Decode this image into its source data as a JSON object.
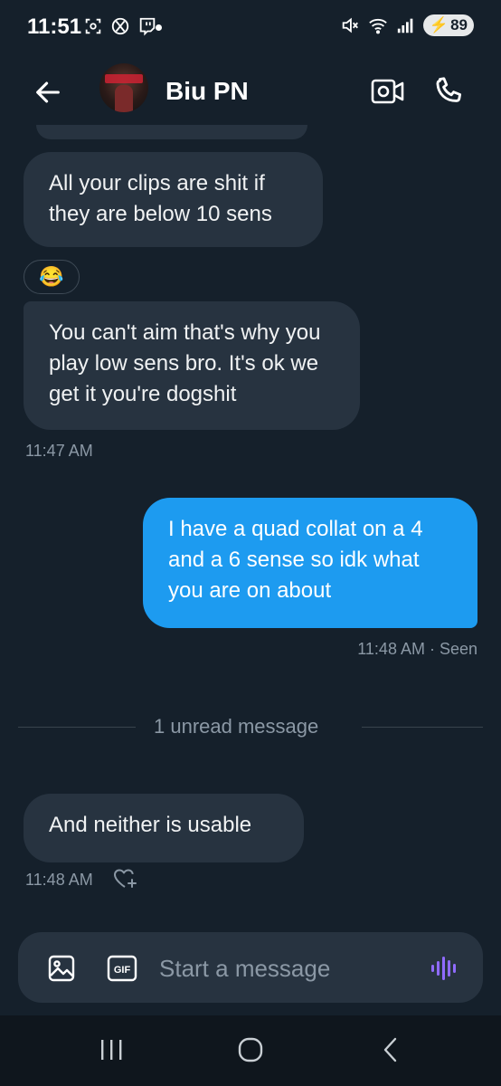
{
  "status_bar": {
    "time": "11:51",
    "battery": "89"
  },
  "header": {
    "contact_name": "Biu PN"
  },
  "messages": [
    {
      "from": "them",
      "text": "All your clips are shit if they are below 10 sens"
    },
    {
      "from": "them",
      "text": "You can't aim that's why you play low sens bro. It's ok we get it you're dogshit",
      "reaction": "😂",
      "timestamp": "11:47 AM"
    },
    {
      "from": "me",
      "text": "I have a quad collat on a 4 and a 6 sense so idk what you are on about",
      "timestamp": "11:48 AM · Seen"
    },
    {
      "from": "them",
      "text": "And neither is usable",
      "timestamp": "11:48 AM"
    }
  ],
  "divider": {
    "label": "1 unread message"
  },
  "composer": {
    "placeholder": "Start a message",
    "gif_label": "GIF"
  },
  "colors": {
    "background": "#15202b",
    "bubble_theirs": "#273340",
    "bubble_mine": "#1d9bf0",
    "voice_accent": "#8f6bff"
  },
  "icons": [
    "back-arrow-icon",
    "video-call-icon",
    "phone-icon",
    "image-icon",
    "gif-icon",
    "voice-message-icon",
    "add-reaction-icon"
  ]
}
